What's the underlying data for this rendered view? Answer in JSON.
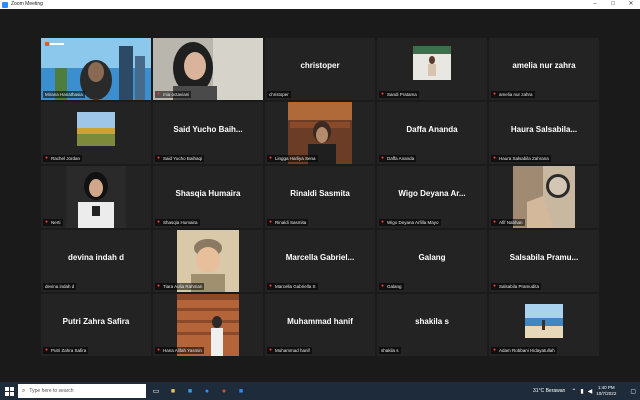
{
  "window": {
    "title": "Zoom Meeting",
    "minimize": "–",
    "maximize": "□",
    "close": "✕"
  },
  "colors": {
    "active_speaker": "#c5e32f",
    "muted_mic": "#e23b3b",
    "tile_bg": "#232323"
  },
  "participants": [
    {
      "name": "Mirana Hanathasia",
      "video": true,
      "active": true
    },
    {
      "name": "mia octaviani",
      "video": true
    },
    {
      "name": "christoper",
      "video": false,
      "display": "christoper"
    },
    {
      "name": "Sandi Pratama",
      "video": true
    },
    {
      "name": "amelia nur zahra",
      "video": false,
      "display": "amelia nur zahra"
    },
    {
      "name": "Rachel Jordan",
      "video": true
    },
    {
      "name": "Said Yucho Baihaqi",
      "video": false,
      "display": "Said Yucho Baih..."
    },
    {
      "name": "Lingga Harliya Sena",
      "video": true
    },
    {
      "name": "Daffa Ananda",
      "video": false,
      "display": "Daffa Ananda"
    },
    {
      "name": "Haura Salsabila Zahrana",
      "video": false,
      "display": "Haura Salsabila..."
    },
    {
      "name": "Nerti",
      "video": true
    },
    {
      "name": "Shasqia Humaira",
      "video": false,
      "display": "Shasqia Humaira"
    },
    {
      "name": "Rinaldi Sasmita",
      "video": false,
      "display": "Rinaldi Sasmita"
    },
    {
      "name": "Wigo Deyana Arfilla Mayo",
      "video": false,
      "display": "Wigo Deyana Ar..."
    },
    {
      "name": "Afif Nabhan",
      "video": true
    },
    {
      "name": "devina indah d",
      "video": false,
      "display": "devina indah d"
    },
    {
      "name": "Tiara Aulia Rahman",
      "video": true
    },
    {
      "name": "Marcella Gabriella S",
      "video": false,
      "display": "Marcella Gabriel..."
    },
    {
      "name": "Galang",
      "video": false,
      "display": "Galang"
    },
    {
      "name": "Salsabila Pramudita",
      "video": false,
      "display": "Salsabila Pramu..."
    },
    {
      "name": "Putri Zahra Safira",
      "video": false,
      "display": "Putri Zahra Safira"
    },
    {
      "name": "Hana Alifah Yasmin",
      "video": true
    },
    {
      "name": "Muhammad hanif",
      "video": false,
      "display": "Muhammad hanif"
    },
    {
      "name": "shakila s",
      "video": false,
      "display": "shakila s"
    },
    {
      "name": "Adam Robbani Hidayatullah",
      "video": true
    }
  ],
  "taskbar": {
    "search_placeholder": "Type here to search",
    "weather": "31°C  Berawan",
    "time": "1:40 PM",
    "date": "10/7/2022"
  }
}
